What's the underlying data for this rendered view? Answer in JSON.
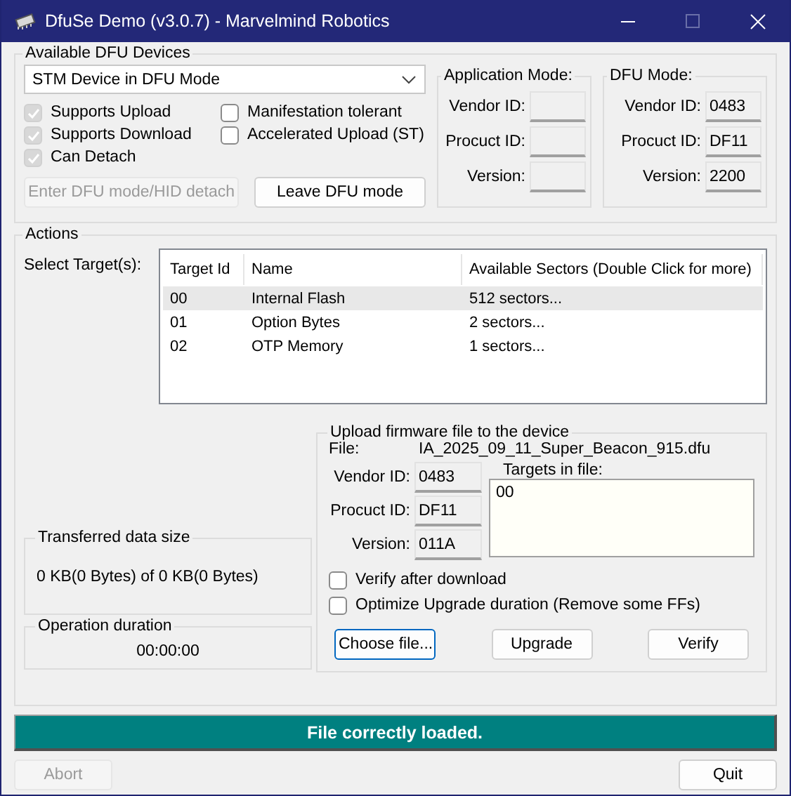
{
  "window": {
    "title": "DfuSe Demo (v3.0.7) - Marvelmind Robotics"
  },
  "devices": {
    "title": "Available DFU Devices",
    "selected_device": "STM Device in DFU Mode",
    "options": [
      {
        "label": "Supports Upload",
        "checked": true,
        "disabled": true
      },
      {
        "label": "Manifestation tolerant",
        "checked": false,
        "disabled": false
      },
      {
        "label": "Supports Download",
        "checked": true,
        "disabled": true
      },
      {
        "label": "Accelerated Upload (ST)",
        "checked": false,
        "disabled": false
      },
      {
        "label": "Can Detach",
        "checked": true,
        "disabled": true
      }
    ],
    "buttons": [
      {
        "label": "Enter DFU mode/HID detach",
        "disabled": true
      },
      {
        "label": "Leave DFU mode",
        "disabled": false
      }
    ]
  },
  "application_mode": {
    "title": "Application Mode:",
    "fields": [
      {
        "label": "Vendor ID:"
      },
      {
        "label": "Procuct ID:"
      },
      {
        "label": "Version:"
      }
    ]
  },
  "dfu_mode": {
    "title": "DFU Mode:",
    "fields": [
      {
        "label": "Vendor ID:",
        "value": "0483"
      },
      {
        "label": "Procuct ID:",
        "value": "DF11"
      },
      {
        "label": "Version:",
        "value": "2200"
      }
    ]
  },
  "actions": {
    "title": "Actions",
    "select_label": "Select Target(s):",
    "targets": {
      "columns": [
        "Target Id",
        "Name",
        "Available Sectors (Double Click for more)"
      ],
      "rows": [
        {
          "cells": [
            "00",
            "Internal Flash",
            "512 sectors..."
          ],
          "selected": true
        },
        {
          "cells": [
            "01",
            "Option Bytes",
            "2 sectors..."
          ],
          "selected": false
        },
        {
          "cells": [
            "02",
            "OTP Memory",
            "1 sectors..."
          ],
          "selected": false
        }
      ]
    },
    "transferred": {
      "title": "Transferred data size",
      "value": "0 KB(0 Bytes) of 0 KB(0 Bytes)"
    },
    "duration": {
      "title": "Operation duration",
      "value": "00:00:00"
    },
    "upload": {
      "title": "Upload firmware file to the device",
      "file_label": "File:",
      "file_name": "IA_2025_09_11_Super_Beacon_915.dfu",
      "fields": [
        {
          "label": "Vendor ID:",
          "value": "0483"
        },
        {
          "label": "Procuct ID:",
          "value": "DF11"
        },
        {
          "label": "Version:",
          "value": "011A"
        }
      ],
      "targets_label": "Targets in file:",
      "targets": [
        "00"
      ],
      "options": [
        {
          "label": "Verify after download",
          "checked": false
        },
        {
          "label": "Optimize Upgrade duration (Remove some FFs)",
          "checked": false
        }
      ],
      "buttons": [
        {
          "label": "Choose file...",
          "focused": true
        },
        {
          "label": "Upgrade",
          "focused": false
        },
        {
          "label": "Verify",
          "focused": false
        }
      ]
    }
  },
  "status": {
    "text": "File correctly loaded."
  },
  "footer_buttons": [
    {
      "label": "Abort",
      "disabled": true
    },
    {
      "label": "Quit",
      "disabled": false
    }
  ]
}
